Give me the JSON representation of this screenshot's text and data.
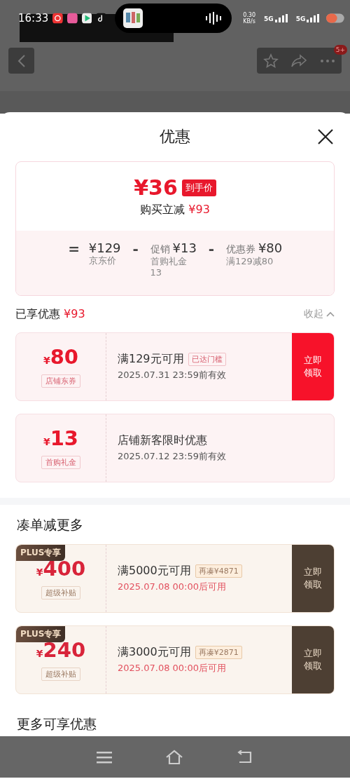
{
  "status_bar": {
    "time": "16:33",
    "net_speed": "0.30",
    "net_unit": "KB/s",
    "signals": [
      "5G",
      "5G"
    ]
  },
  "header": {
    "badge": "5+"
  },
  "sheet": {
    "title": "优惠",
    "summary": {
      "price": "¥36",
      "price_tag": "到手价",
      "saving_label": "购买立减",
      "saving": "¥93",
      "breakdown": [
        {
          "op": "=",
          "amount": "¥129",
          "note": "京东价"
        },
        {
          "op": "-",
          "amount": "¥13",
          "label": "促销",
          "note": "首购礼金\n13"
        },
        {
          "op": "-",
          "amount": "¥80",
          "label": "优惠券",
          "note": "满129减80"
        }
      ]
    },
    "enjoyed": {
      "label": "已享优惠",
      "amount": "¥93",
      "toggle": "收起"
    },
    "coupons": [
      {
        "kind": "store",
        "currency": "¥",
        "amount": "80",
        "tag": "店铺东券",
        "title": "满129元可用",
        "badge": "已达门槛",
        "date": "2025.07.31 23:59前有效",
        "button": "立即领取"
      },
      {
        "kind": "store",
        "currency": "¥",
        "amount": "13",
        "tag": "首购礼金",
        "title": "店铺新客限时优惠",
        "date": "2025.07.12 23:59前有效"
      }
    ],
    "more_section": {
      "title": "凑单减更多",
      "coupons": [
        {
          "kind": "plus",
          "ribbon": "PLUS专享",
          "currency": "¥",
          "amount": "400",
          "tag": "超级补贴",
          "title": "满5000元可用",
          "badge": "再凑¥4871",
          "date": "2025.07.08 00:00后可用",
          "button": "立即领取"
        },
        {
          "kind": "plus",
          "ribbon": "PLUS专享",
          "currency": "¥",
          "amount": "240",
          "tag": "超级补贴",
          "title": "满3000元可用",
          "badge": "再凑¥2871",
          "date": "2025.07.08 00:00后可用",
          "button": "立即领取"
        }
      ]
    },
    "next_section": {
      "title": "更多可享优惠"
    }
  }
}
